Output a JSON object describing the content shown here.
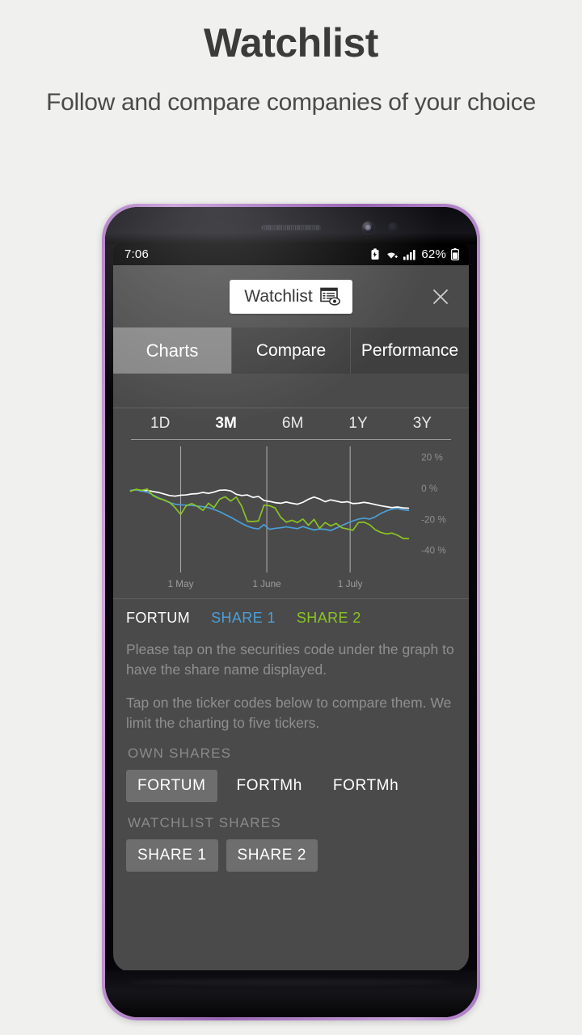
{
  "promo": {
    "title": "Watchlist",
    "subtitle": "Follow and compare companies of your choice"
  },
  "statusbar": {
    "time": "7:06",
    "battery_percent": "62%",
    "icons": [
      "battery-saver-icon",
      "wifi-icon",
      "cellular-signal-icon",
      "battery-icon"
    ]
  },
  "app_header": {
    "chip_label": "Watchlist",
    "chip_icon": "watchlist-document-eye-icon",
    "close_icon": "close-icon"
  },
  "tabs": [
    {
      "label": "Charts",
      "active": true
    },
    {
      "label": "Compare",
      "active": false
    },
    {
      "label": "Performance",
      "active": false
    }
  ],
  "ranges": [
    {
      "label": "1D",
      "active": false
    },
    {
      "label": "3M",
      "active": true
    },
    {
      "label": "6M",
      "active": false
    },
    {
      "label": "1Y",
      "active": false
    },
    {
      "label": "3Y",
      "active": false
    }
  ],
  "legend": [
    {
      "label": "FORTUM",
      "color": "#ffffff"
    },
    {
      "label": "SHARE 1",
      "color": "#4a9fd8"
    },
    {
      "label": "SHARE 2",
      "color": "#8ac522"
    }
  ],
  "hints": [
    "Please tap on the securities code under the graph to have the share name displayed.",
    "Tap on the ticker codes below to compare them. We limit the charting to five tickers."
  ],
  "own_shares": {
    "label": "OWN SHARES",
    "chips": [
      {
        "label": "FORTUM",
        "selected": true
      },
      {
        "label": "FORTMh",
        "selected": false
      },
      {
        "label": "FORTMh",
        "selected": false
      }
    ]
  },
  "watchlist_shares": {
    "label": "WATCHLIST SHARES",
    "chips": [
      {
        "label": "SHARE 1",
        "selected": true
      },
      {
        "label": "SHARE 2",
        "selected": true
      }
    ]
  },
  "chart_data": {
    "type": "line",
    "title": "",
    "xlabel": "",
    "ylabel": "",
    "ylim": [
      -48,
      24
    ],
    "yticks": [
      20,
      0,
      -20,
      -40
    ],
    "ytick_labels": [
      "20 %",
      "0 %",
      "-20 %",
      "-40 %"
    ],
    "xticks": [
      18,
      49,
      79
    ],
    "xtick_labels": [
      "1 May",
      "1 June",
      "1 July"
    ],
    "xlim": [
      0,
      100
    ],
    "grid": "vertical-only",
    "legend_position": "below",
    "series": [
      {
        "name": "FORTUM",
        "color": "#ffffff",
        "x": [
          0,
          2,
          4,
          6,
          8,
          10,
          12,
          14,
          16,
          18,
          20,
          22,
          24,
          26,
          28,
          30,
          32,
          34,
          36,
          38,
          40,
          42,
          44,
          46,
          48,
          50,
          52,
          54,
          56,
          58,
          60,
          62,
          64,
          66,
          68,
          70,
          72,
          74,
          76,
          78,
          80,
          82,
          84,
          86,
          88,
          90,
          92,
          94,
          96,
          98,
          100
        ],
        "values": [
          -1.5,
          -0.8,
          -1.8,
          -1.2,
          -2.0,
          -2.6,
          -3.6,
          -4.6,
          -5.0,
          -4.4,
          -4.2,
          -3.6,
          -3.4,
          -2.6,
          -3.2,
          -2.4,
          -1.2,
          -1.0,
          -1.6,
          -3.8,
          -4.6,
          -4.2,
          -5.8,
          -5.2,
          -7.8,
          -8.4,
          -9.2,
          -9.6,
          -8.8,
          -9.6,
          -10.2,
          -9.0,
          -7.0,
          -5.6,
          -6.8,
          -8.6,
          -7.4,
          -8.2,
          -9.0,
          -8.6,
          -9.8,
          -9.6,
          -9.0,
          -9.6,
          -10.4,
          -11.2,
          -11.8,
          -12.4,
          -12.0,
          -12.6,
          -12.8
        ]
      },
      {
        "name": "SHARE 1",
        "color": "#4a9fd8",
        "x": [
          0,
          2,
          4,
          6,
          8,
          10,
          12,
          14,
          16,
          18,
          20,
          22,
          24,
          26,
          28,
          30,
          32,
          34,
          36,
          38,
          40,
          42,
          44,
          46,
          48,
          50,
          52,
          54,
          56,
          58,
          60,
          62,
          64,
          66,
          68,
          70,
          72,
          74,
          76,
          78,
          80,
          82,
          84,
          86,
          88,
          90,
          92,
          94,
          96,
          98,
          100
        ],
        "values": [
          -1.2,
          -1.0,
          -1.8,
          -2.4,
          -4.2,
          -6.0,
          -7.6,
          -9.2,
          -10.2,
          -10.6,
          -10.8,
          -11.0,
          -11.4,
          -11.8,
          -12.4,
          -13.6,
          -15.0,
          -16.8,
          -18.6,
          -20.6,
          -22.6,
          -24.4,
          -25.6,
          -26.2,
          -23.4,
          -26.4,
          -25.8,
          -25.4,
          -24.8,
          -25.4,
          -26.0,
          -24.6,
          -25.8,
          -26.8,
          -26.2,
          -26.4,
          -27.2,
          -25.6,
          -24.0,
          -22.4,
          -21.0,
          -19.8,
          -19.2,
          -19.8,
          -18.4,
          -16.2,
          -14.6,
          -13.4,
          -13.0,
          -13.8,
          -14.2
        ]
      },
      {
        "name": "SHARE 2",
        "color": "#8ac522",
        "x": [
          0,
          2,
          4,
          6,
          8,
          10,
          12,
          14,
          16,
          18,
          20,
          22,
          24,
          26,
          28,
          30,
          32,
          34,
          36,
          38,
          40,
          42,
          44,
          46,
          48,
          50,
          52,
          54,
          56,
          58,
          60,
          62,
          64,
          66,
          68,
          70,
          72,
          74,
          76,
          78,
          80,
          82,
          84,
          86,
          88,
          90,
          92,
          94,
          96,
          98,
          100
        ],
        "values": [
          -1.8,
          -0.6,
          -1.2,
          -0.4,
          -4.6,
          -6.4,
          -7.4,
          -9.0,
          -12.4,
          -16.8,
          -11.2,
          -9.8,
          -11.6,
          -14.2,
          -9.6,
          -12.4,
          -7.0,
          -5.4,
          -8.2,
          -5.6,
          -11.6,
          -21.2,
          -21.4,
          -21.0,
          -10.8,
          -11.2,
          -12.6,
          -18.6,
          -21.8,
          -20.6,
          -22.0,
          -19.8,
          -23.8,
          -20.0,
          -25.8,
          -22.0,
          -24.2,
          -22.6,
          -25.4,
          -26.2,
          -27.0,
          -22.0,
          -21.8,
          -23.4,
          -26.6,
          -28.4,
          -29.4,
          -28.8,
          -30.2,
          -32.2,
          -32.4
        ]
      }
    ]
  }
}
